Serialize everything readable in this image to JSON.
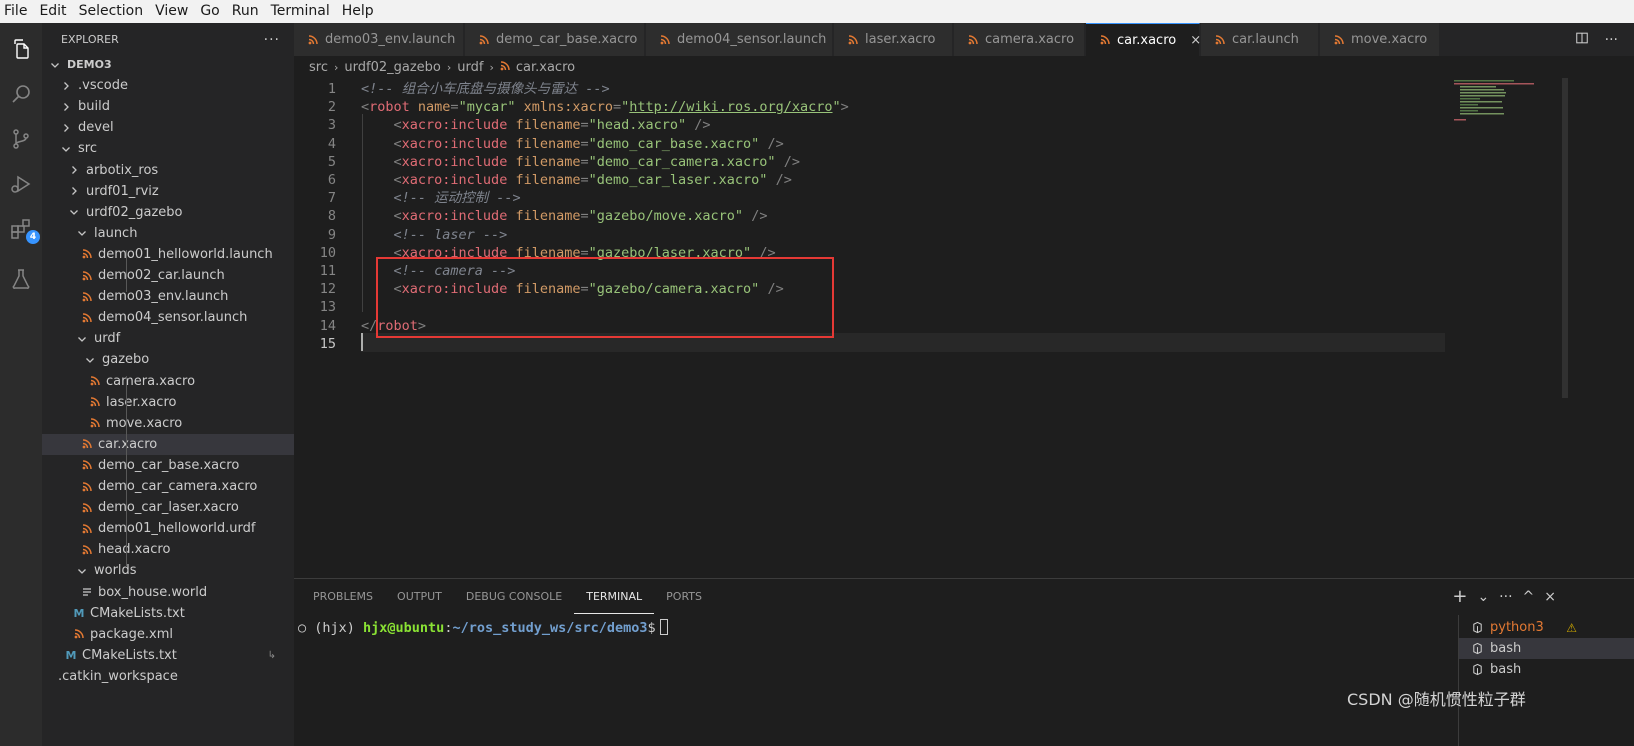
{
  "menubar": {
    "items": [
      "File",
      "Edit",
      "Selection",
      "View",
      "Go",
      "Run",
      "Terminal",
      "Help"
    ]
  },
  "activity": {
    "icons": [
      "explorer-icon",
      "search-icon",
      "source-control-icon",
      "run-debug-icon",
      "extensions-icon",
      "testing-icon"
    ],
    "extensions_badge": "4"
  },
  "sidebar": {
    "title": "EXPLORER",
    "more": "···",
    "tree": [
      {
        "label": "DEMO3",
        "depth": 0,
        "kind": "folder-open",
        "root": true
      },
      {
        "label": ".vscode",
        "depth": 1,
        "kind": "folder-closed"
      },
      {
        "label": "build",
        "depth": 1,
        "kind": "folder-closed"
      },
      {
        "label": "devel",
        "depth": 1,
        "kind": "folder-closed"
      },
      {
        "label": "src",
        "depth": 1,
        "kind": "folder-open"
      },
      {
        "label": "arbotix_ros",
        "depth": 2,
        "kind": "folder-closed"
      },
      {
        "label": "urdf01_rviz",
        "depth": 2,
        "kind": "folder-closed"
      },
      {
        "label": "urdf02_gazebo",
        "depth": 2,
        "kind": "folder-open"
      },
      {
        "label": "launch",
        "depth": 3,
        "kind": "folder-open"
      },
      {
        "label": "demo01_helloworld.launch",
        "depth": 4,
        "kind": "rss"
      },
      {
        "label": "demo02_car.launch",
        "depth": 4,
        "kind": "rss"
      },
      {
        "label": "demo03_env.launch",
        "depth": 4,
        "kind": "rss"
      },
      {
        "label": "demo04_sensor.launch",
        "depth": 4,
        "kind": "rss"
      },
      {
        "label": "urdf",
        "depth": 3,
        "kind": "folder-open"
      },
      {
        "label": "gazebo",
        "depth": 4,
        "kind": "folder-open"
      },
      {
        "label": "camera.xacro",
        "depth": 5,
        "kind": "rss"
      },
      {
        "label": "laser.xacro",
        "depth": 5,
        "kind": "rss"
      },
      {
        "label": "move.xacro",
        "depth": 5,
        "kind": "rss"
      },
      {
        "label": "car.xacro",
        "depth": 4,
        "kind": "rss",
        "selected": true
      },
      {
        "label": "demo_car_base.xacro",
        "depth": 4,
        "kind": "rss"
      },
      {
        "label": "demo_car_camera.xacro",
        "depth": 4,
        "kind": "rss"
      },
      {
        "label": "demo_car_laser.xacro",
        "depth": 4,
        "kind": "rss"
      },
      {
        "label": "demo01_helloworld.urdf",
        "depth": 4,
        "kind": "rss"
      },
      {
        "label": "head.xacro",
        "depth": 4,
        "kind": "rss"
      },
      {
        "label": "worlds",
        "depth": 3,
        "kind": "folder-open"
      },
      {
        "label": "box_house.world",
        "depth": 4,
        "kind": "world"
      },
      {
        "label": "CMakeLists.txt",
        "depth": 3,
        "kind": "cmake"
      },
      {
        "label": "package.xml",
        "depth": 3,
        "kind": "rss"
      },
      {
        "label": "CMakeLists.txt",
        "depth": 2,
        "kind": "cmake",
        "extra": "↳"
      },
      {
        "label": ".catkin_workspace",
        "depth": 1,
        "kind": "plain"
      }
    ]
  },
  "tabs": [
    {
      "label": "demo03_env.launch",
      "active": false
    },
    {
      "label": "demo_car_base.xacro",
      "active": false
    },
    {
      "label": "demo04_sensor.launch",
      "active": false
    },
    {
      "label": "laser.xacro",
      "active": false
    },
    {
      "label": "camera.xacro",
      "active": false
    },
    {
      "label": "car.xacro",
      "active": true
    },
    {
      "label": "car.launch",
      "active": false
    },
    {
      "label": "move.xacro",
      "active": false
    }
  ],
  "tab_close": "×",
  "breadcrumb": {
    "parts": [
      "src",
      "urdf02_gazebo",
      "urdf",
      "car.xacro"
    ]
  },
  "editor": {
    "lines": [
      {
        "n": "1",
        "indent": "",
        "tokens": [
          [
            "c-com2",
            "<!-- 组合小车底盘与摄像头与雷达 -->"
          ]
        ]
      },
      {
        "n": "2",
        "indent": "",
        "tokens": [
          [
            "c-punct",
            "<"
          ],
          [
            "c-tag",
            "robot"
          ],
          [
            "c-attr",
            " name"
          ],
          [
            "c-punct",
            "="
          ],
          [
            "c-str",
            "\"mycar\""
          ],
          [
            "c-attr",
            " xmlns:xacro"
          ],
          [
            "c-punct",
            "="
          ],
          [
            "c-str",
            "\""
          ],
          [
            "c-link",
            "http://wiki.ros.org/xacro"
          ],
          [
            "c-str",
            "\""
          ],
          [
            "c-punct",
            ">"
          ]
        ]
      },
      {
        "n": "3",
        "indent": "    ",
        "tokens": [
          [
            "c-punct",
            "<"
          ],
          [
            "c-tag",
            "xacro:include"
          ],
          [
            "c-attr",
            " filename"
          ],
          [
            "c-punct",
            "="
          ],
          [
            "c-str",
            "\"head.xacro\""
          ],
          [
            "c-punct",
            " />"
          ]
        ]
      },
      {
        "n": "4",
        "indent": "    ",
        "tokens": [
          [
            "c-punct",
            "<"
          ],
          [
            "c-tag",
            "xacro:include"
          ],
          [
            "c-attr",
            " filename"
          ],
          [
            "c-punct",
            "="
          ],
          [
            "c-str",
            "\"demo_car_base.xacro\""
          ],
          [
            "c-punct",
            " />"
          ]
        ]
      },
      {
        "n": "5",
        "indent": "    ",
        "tokens": [
          [
            "c-punct",
            "<"
          ],
          [
            "c-tag",
            "xacro:include"
          ],
          [
            "c-attr",
            " filename"
          ],
          [
            "c-punct",
            "="
          ],
          [
            "c-str",
            "\"demo_car_camera.xacro\""
          ],
          [
            "c-punct",
            " />"
          ]
        ]
      },
      {
        "n": "6",
        "indent": "    ",
        "tokens": [
          [
            "c-punct",
            "<"
          ],
          [
            "c-tag",
            "xacro:include"
          ],
          [
            "c-attr",
            " filename"
          ],
          [
            "c-punct",
            "="
          ],
          [
            "c-str",
            "\"demo_car_laser.xacro\""
          ],
          [
            "c-punct",
            " />"
          ]
        ]
      },
      {
        "n": "7",
        "indent": "    ",
        "tokens": [
          [
            "c-com2",
            "<!-- 运动控制 -->"
          ]
        ]
      },
      {
        "n": "8",
        "indent": "    ",
        "tokens": [
          [
            "c-punct",
            "<"
          ],
          [
            "c-tag",
            "xacro:include"
          ],
          [
            "c-attr",
            " filename"
          ],
          [
            "c-punct",
            "="
          ],
          [
            "c-str",
            "\"gazebo/move.xacro\""
          ],
          [
            "c-punct",
            " />"
          ]
        ]
      },
      {
        "n": "9",
        "indent": "    ",
        "tokens": [
          [
            "c-com2",
            "<!-- laser -->"
          ]
        ]
      },
      {
        "n": "10",
        "indent": "    ",
        "tokens": [
          [
            "c-punct",
            "<"
          ],
          [
            "c-tag",
            "xacro:include"
          ],
          [
            "c-attr",
            " filename"
          ],
          [
            "c-punct",
            "="
          ],
          [
            "c-str",
            "\"gazebo/laser.xacro\""
          ],
          [
            "c-punct",
            " />"
          ]
        ]
      },
      {
        "n": "11",
        "indent": "    ",
        "tokens": [
          [
            "c-com2",
            "<!-- camera -->"
          ]
        ]
      },
      {
        "n": "12",
        "indent": "    ",
        "tokens": [
          [
            "c-punct",
            "<"
          ],
          [
            "c-tag",
            "xacro:include"
          ],
          [
            "c-attr",
            " filename"
          ],
          [
            "c-punct",
            "="
          ],
          [
            "c-str",
            "\"gazebo/camera.xacro\""
          ],
          [
            "c-punct",
            " />"
          ]
        ]
      },
      {
        "n": "13",
        "indent": "",
        "tokens": []
      },
      {
        "n": "14",
        "indent": "",
        "tokens": [
          [
            "c-punct",
            "</"
          ],
          [
            "c-tag",
            "robot"
          ],
          [
            "c-punct",
            ">"
          ]
        ]
      },
      {
        "n": "15",
        "indent": "",
        "tokens": []
      }
    ]
  },
  "panel": {
    "tabs": [
      {
        "label": "PROBLEMS",
        "active": false
      },
      {
        "label": "OUTPUT",
        "active": false
      },
      {
        "label": "DEBUG CONSOLE",
        "active": false
      },
      {
        "label": "TERMINAL",
        "active": true
      },
      {
        "label": "PORTS",
        "active": false
      }
    ],
    "actions": [
      "+",
      "⌄",
      "···",
      "^",
      "×"
    ],
    "terminal": {
      "prefix": "○ (hjx) ",
      "user": "hjx@ubuntu",
      "colon": ":",
      "path": "~/ros_study_ws/src/demo3",
      "suffix": "$"
    },
    "terminals": [
      {
        "label": "python3",
        "active": false,
        "warn": "⚠"
      },
      {
        "label": "bash",
        "active": true
      },
      {
        "label": "bash",
        "active": false
      }
    ]
  },
  "watermark": "CSDN @随机惯性粒子群"
}
